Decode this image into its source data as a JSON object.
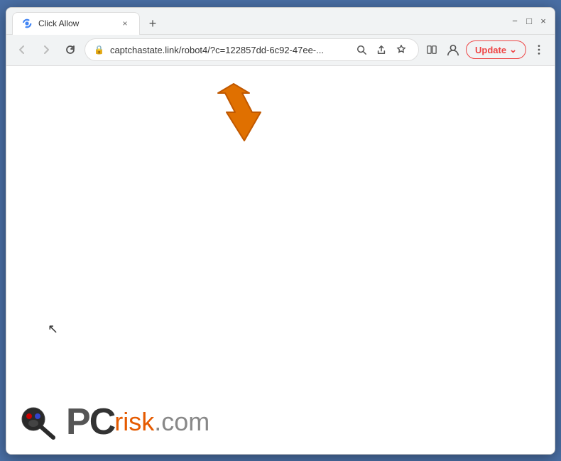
{
  "window": {
    "title": "Click Allow",
    "tab_title": "Click Allow",
    "url": "captchastate.link/robot4/?c=122857dd-6c92-47ee-...",
    "update_label": "Update",
    "new_tab_label": "+",
    "favicon": "spinner"
  },
  "nav": {
    "back_title": "Back",
    "forward_title": "Forward",
    "reload_title": "Reload"
  },
  "address_bar": {
    "lock_title": "Secure",
    "url_display": "captchastate.link/robot4/?c=122857dd-6c92-47ee-..."
  },
  "watermark": {
    "pc_text": "PC",
    "risk_text": "risk",
    "domain_text": ".com"
  },
  "window_controls": {
    "minimize": "−",
    "maximize": "□",
    "close": "×"
  }
}
